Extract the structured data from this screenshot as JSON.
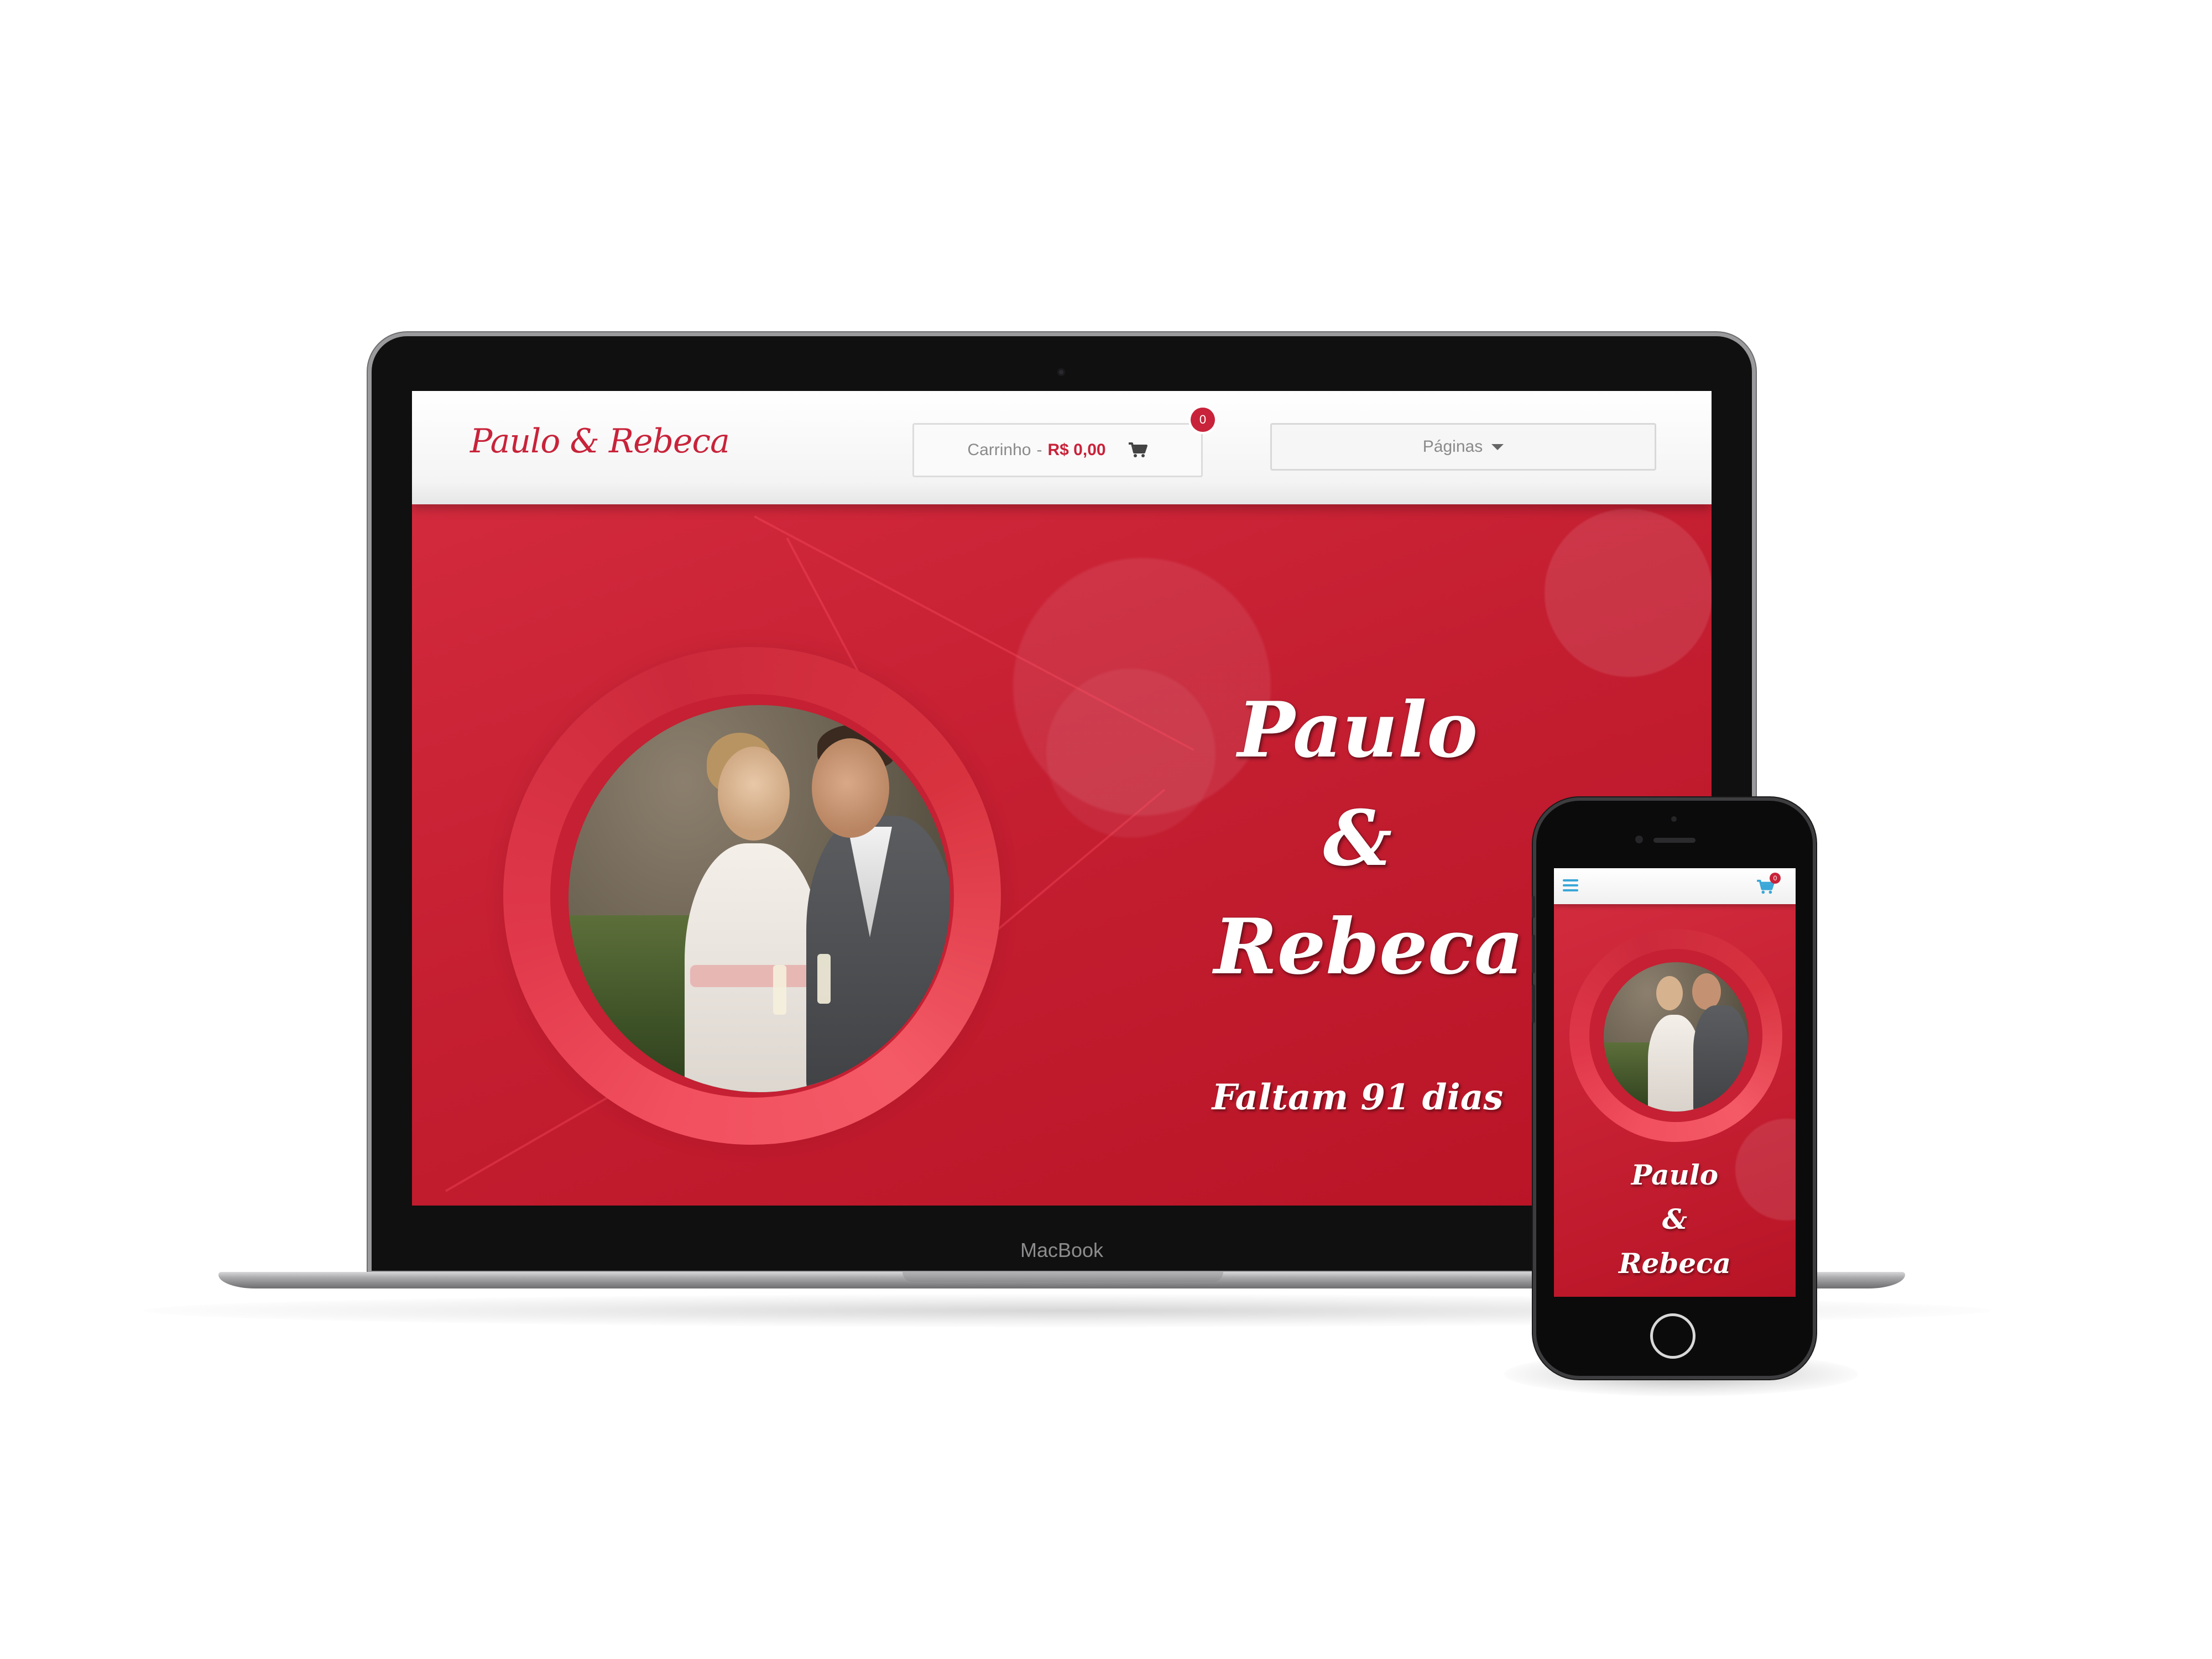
{
  "laptop": {
    "brand": "MacBook"
  },
  "site": {
    "logo": "Paulo & Rebeca",
    "cart": {
      "label": "Carrinho",
      "separator": "-",
      "price": "R$ 0,00",
      "badge": "0"
    },
    "pages_menu": {
      "label": "Páginas"
    },
    "hero": {
      "name_1": "Paulo",
      "ampersand": "&",
      "name_2": "Rebeca",
      "countdown": "Faltam 91 dias"
    }
  },
  "mobile": {
    "cart_badge": "0",
    "hero": {
      "name_1": "Paulo",
      "ampersand": "&",
      "name_2": "Rebeca"
    }
  },
  "colors": {
    "brand_red": "#c8233a",
    "hero_red": "#c41e31",
    "mobile_accent": "#3aa7d8"
  },
  "icons": {
    "cart": "shopping-cart-icon",
    "caret": "caret-down-icon",
    "menu": "hamburger-menu-icon"
  }
}
